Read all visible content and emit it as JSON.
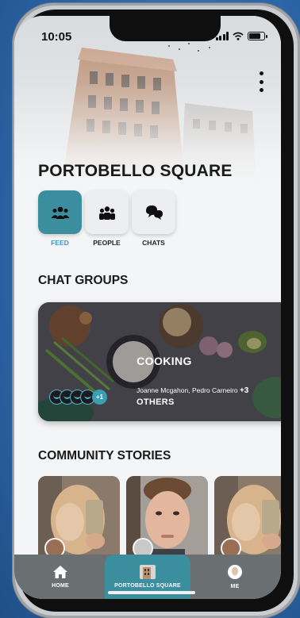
{
  "status_bar": {
    "time": "10:05"
  },
  "header": {
    "title": "PORTOBELLO SQUARE",
    "menu_icon": "kebab-menu-icon"
  },
  "tabs": [
    {
      "label": "FEED",
      "icon": "people-group-icon",
      "active": true
    },
    {
      "label": "PEOPLE",
      "icon": "people-icon",
      "active": false
    },
    {
      "label": "CHATS",
      "icon": "chat-bubbles-icon",
      "active": false
    }
  ],
  "chat_groups": {
    "title": "CHAT GROUPS",
    "card": {
      "name": "COOKING",
      "member_count_badge": "+1",
      "members_text": "Joanne Mcgahon, Pedro Carneiro",
      "members_more": "+3",
      "others_label": "OTHERS"
    }
  },
  "community_stories": {
    "title": "COMMUNITY STORIES",
    "items": [
      {
        "kind": "selfie-woman"
      },
      {
        "kind": "selfie-man"
      },
      {
        "kind": "selfie-woman"
      }
    ]
  },
  "bottom_nav": {
    "items": [
      {
        "label": "HOME",
        "icon": "home-icon",
        "active": false
      },
      {
        "label": "PORTOBELLO SQUARE",
        "icon": "building-thumbnail-icon",
        "active": true
      },
      {
        "label": "ME",
        "icon": "profile-icon",
        "active": false
      }
    ]
  },
  "colors": {
    "accent": "#3a8e9e",
    "active_tab_label": "#2f9bd6",
    "nav_background": "#6a6f72",
    "outer_background": "#2f6fb3"
  }
}
